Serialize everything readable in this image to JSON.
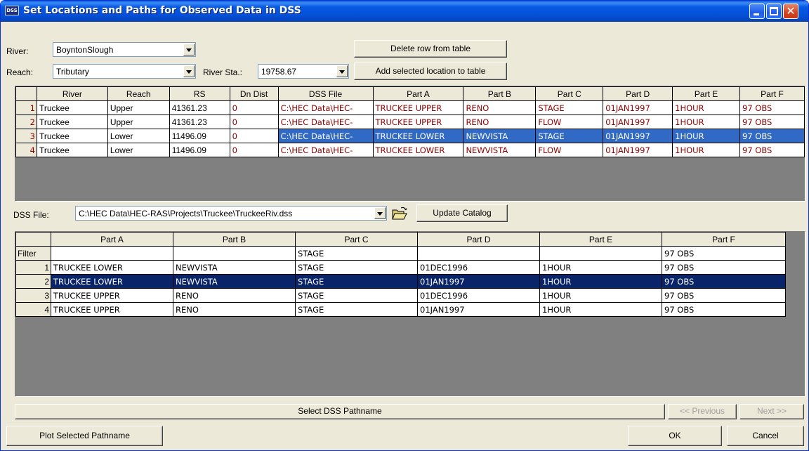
{
  "window": {
    "icon_text": "DSS",
    "title": "Set Locations and Paths for Observed Data in DSS",
    "controls": [
      "minimize-icon",
      "maximize-icon",
      "close-icon"
    ],
    "close_glyph": "✕"
  },
  "location": {
    "river_label": "River:",
    "river_value": "BoyntonSlough",
    "reach_label": "Reach:",
    "reach_value": "Tributary",
    "river_sta_label": "River Sta.:",
    "river_sta_value": "19758.67",
    "delete_row_button": "Delete row from table",
    "add_location_button": "Add selected location to table"
  },
  "location_table": {
    "columns": [
      "River",
      "Reach",
      "RS",
      "Dn Dist",
      "DSS File",
      "Part A",
      "Part B",
      "Part C",
      "Part D",
      "Part E",
      "Part F"
    ],
    "selected_row": 3,
    "rows": [
      {
        "num": "1",
        "river": "Truckee",
        "reach": "Upper",
        "rs": "41361.23",
        "dn_dist": "0",
        "dss_file": "C:\\HEC Data\\HEC-",
        "part_a": "TRUCKEE UPPER",
        "part_b": "RENO",
        "part_c": "STAGE",
        "part_d": "01JAN1997",
        "part_e": "1HOUR",
        "part_f": "97 OBS"
      },
      {
        "num": "2",
        "river": "Truckee",
        "reach": "Upper",
        "rs": "41361.23",
        "dn_dist": "0",
        "dss_file": "C:\\HEC Data\\HEC-",
        "part_a": "TRUCKEE UPPER",
        "part_b": "RENO",
        "part_c": "FLOW",
        "part_d": "01JAN1997",
        "part_e": "1HOUR",
        "part_f": "97 OBS"
      },
      {
        "num": "3",
        "river": "Truckee",
        "reach": "Lower",
        "rs": "11496.09",
        "dn_dist": "0",
        "dss_file": "C:\\HEC Data\\HEC-",
        "part_a": "TRUCKEE LOWER",
        "part_b": "NEWVISTA",
        "part_c": "STAGE",
        "part_d": "01JAN1997",
        "part_e": "1HOUR",
        "part_f": "97 OBS"
      },
      {
        "num": "4",
        "river": "Truckee",
        "reach": "Lower",
        "rs": "11496.09",
        "dn_dist": "0",
        "dss_file": "C:\\HEC Data\\HEC-",
        "part_a": "TRUCKEE LOWER",
        "part_b": "NEWVISTA",
        "part_c": "FLOW",
        "part_d": "01JAN1997",
        "part_e": "1HOUR",
        "part_f": "97 OBS"
      }
    ]
  },
  "dss": {
    "file_label": "DSS File:",
    "file_value": "C:\\HEC Data\\HEC-RAS\\Projects\\Truckee\\TruckeeRiv.dss",
    "open_icon": "open-folder-icon",
    "update_catalog_button": "Update Catalog"
  },
  "catalog_table": {
    "columns": [
      "Part A",
      "Part B",
      "Part C",
      "Part D",
      "Part E",
      "Part F"
    ],
    "filter_label": "Filter",
    "filter": {
      "part_a": "",
      "part_b": "",
      "part_c": "STAGE",
      "part_d": "",
      "part_e": "",
      "part_f": "97 OBS"
    },
    "selected_row": 2,
    "rows": [
      {
        "num": "1",
        "part_a": "TRUCKEE LOWER",
        "part_b": "NEWVISTA",
        "part_c": "STAGE",
        "part_d": "01DEC1996",
        "part_e": "1HOUR",
        "part_f": "97 OBS"
      },
      {
        "num": "2",
        "part_a": "TRUCKEE LOWER",
        "part_b": "NEWVISTA",
        "part_c": "STAGE",
        "part_d": "01JAN1997",
        "part_e": "1HOUR",
        "part_f": "97 OBS"
      },
      {
        "num": "3",
        "part_a": "TRUCKEE UPPER",
        "part_b": "RENO",
        "part_c": "STAGE",
        "part_d": "01DEC1996",
        "part_e": "1HOUR",
        "part_f": "97 OBS"
      },
      {
        "num": "4",
        "part_a": "TRUCKEE UPPER",
        "part_b": "RENO",
        "part_c": "STAGE",
        "part_d": "01JAN1997",
        "part_e": "1HOUR",
        "part_f": "97 OBS"
      }
    ]
  },
  "footer": {
    "select_pathname_button": "Select DSS Pathname",
    "previous_button": "<< Previous",
    "next_button": "Next >>",
    "plot_button": "Plot Selected Pathname",
    "ok_button": "OK",
    "cancel_button": "Cancel"
  },
  "colors": {
    "title_bar": "#0550d8",
    "dialog_bg": "#ece9d8",
    "grid_bg": "#808080",
    "location_selection": "#316ac5",
    "catalog_selection": "#0a246a",
    "location_text": "#8b0000"
  }
}
